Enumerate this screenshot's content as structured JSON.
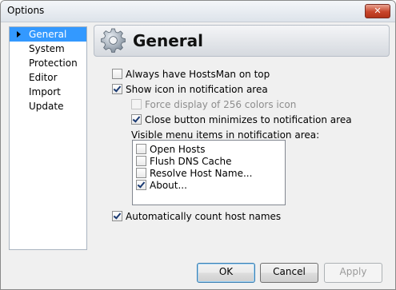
{
  "window": {
    "title": "Options",
    "close_glyph": "✕"
  },
  "sidebar": {
    "items": [
      {
        "label": "General"
      },
      {
        "label": "System"
      },
      {
        "label": "Protection"
      },
      {
        "label": "Editor"
      },
      {
        "label": "Import"
      },
      {
        "label": "Update"
      }
    ]
  },
  "header": {
    "title": "General",
    "icon": "gear-icon"
  },
  "options": {
    "always_on_top": {
      "label": "Always have HostsMan on top",
      "checked": false
    },
    "show_icon": {
      "label": "Show icon in notification area",
      "checked": true
    },
    "force_256": {
      "label": "Force display of 256 colors icon",
      "checked": false,
      "disabled": true
    },
    "close_minimizes": {
      "label": "Close button minimizes to notification area",
      "checked": true
    },
    "visible_menu_label": "Visible menu items in notification area:",
    "menu_items": [
      {
        "label": "Open Hosts",
        "checked": false
      },
      {
        "label": "Flush DNS Cache",
        "checked": false
      },
      {
        "label": "Resolve Host Name...",
        "checked": false
      },
      {
        "label": "About...",
        "checked": true
      }
    ],
    "auto_count": {
      "label": "Automatically count host names",
      "checked": true
    }
  },
  "buttons": {
    "ok": "OK",
    "cancel": "Cancel",
    "apply": "Apply"
  }
}
